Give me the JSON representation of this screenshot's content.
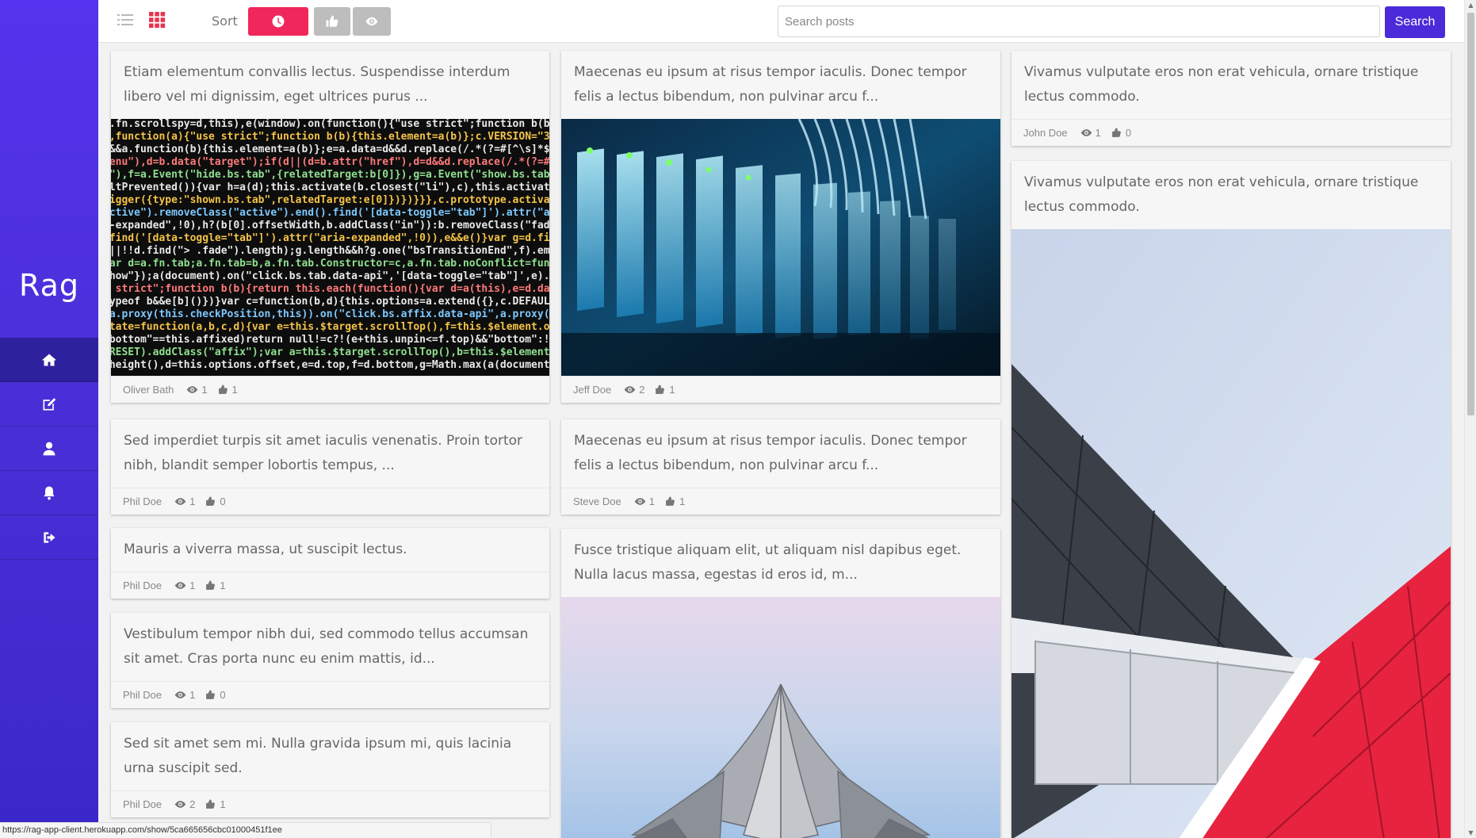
{
  "sidebar": {
    "logo": "Rag",
    "nav": [
      {
        "icon": "home-icon",
        "active": true
      },
      {
        "icon": "edit-icon",
        "active": false
      },
      {
        "icon": "user-icon",
        "active": false
      },
      {
        "icon": "bell-icon",
        "active": false
      },
      {
        "icon": "sign-out-icon",
        "active": false
      }
    ]
  },
  "toolbar": {
    "sort_label": "Sort",
    "search_placeholder": "Search posts",
    "search_value": "",
    "search_button": "Search",
    "colors": {
      "active_sort": "#f0275a",
      "inactive_sort": "#bdbdbd",
      "grid_icon": "#e8334f",
      "list_icon": "#b9b9b9"
    }
  },
  "posts": [
    {
      "text": "Etiam elementum convallis lectus. Suspendisse interdum libero vel mi dignissim, eget ultrices purus ...",
      "image": "code",
      "author": "Oliver Bath",
      "views": "1",
      "likes": "1"
    },
    {
      "text": "Sed imperdiet turpis sit amet iaculis venenatis. Proin tortor nibh, blandit semper lobortis tempus, ...",
      "image": null,
      "author": "Phil Doe",
      "views": "1",
      "likes": "0"
    },
    {
      "text": "Mauris a viverra massa, ut suscipit lectus.",
      "image": null,
      "author": "Phil Doe",
      "views": "1",
      "likes": "1"
    },
    {
      "text": "Vestibulum tempor nibh dui, sed commodo tellus accumsan sit amet. Cras porta nunc eu enim mattis, id...",
      "image": null,
      "author": "Phil Doe",
      "views": "1",
      "likes": "0"
    },
    {
      "text": "Sed sit amet sem mi. Nulla gravida ipsum mi, quis lacinia urna suscipit sed.",
      "image": null,
      "author": "Phil Doe",
      "views": "2",
      "likes": "1"
    },
    {
      "text": "Maecenas eu ipsum at risus tempor iaculis. Donec tempor felis a lectus bibendum, non pulvinar arcu f...",
      "image": "servers",
      "author": "Jeff Doe",
      "views": "2",
      "likes": "1"
    },
    {
      "text": "Maecenas eu ipsum at risus tempor iaculis. Donec tempor felis a lectus bibendum, non pulvinar arcu f...",
      "image": null,
      "author": "Steve Doe",
      "views": "1",
      "likes": "1"
    },
    {
      "text": "Fusce tristique aliquam elit, ut aliquam nisl dapibus eget. Nulla lacus massa, egestas id eros id, m...",
      "image": "lotus",
      "author": "",
      "views": "",
      "likes": ""
    },
    {
      "text": "Vivamus vulputate eros non erat vehicula, ornare tristique lectus commodo.",
      "image": null,
      "author": "John Doe",
      "views": "1",
      "likes": "0"
    },
    {
      "text": "Vivamus vulputate eros non erat vehicula, ornare tristique lectus commodo.",
      "image": "building",
      "author": "",
      "views": "",
      "likes": ""
    }
  ],
  "status_url": "https://rag-app-client.herokuapp.com/show/5ca665656cbc01000451f1ee"
}
